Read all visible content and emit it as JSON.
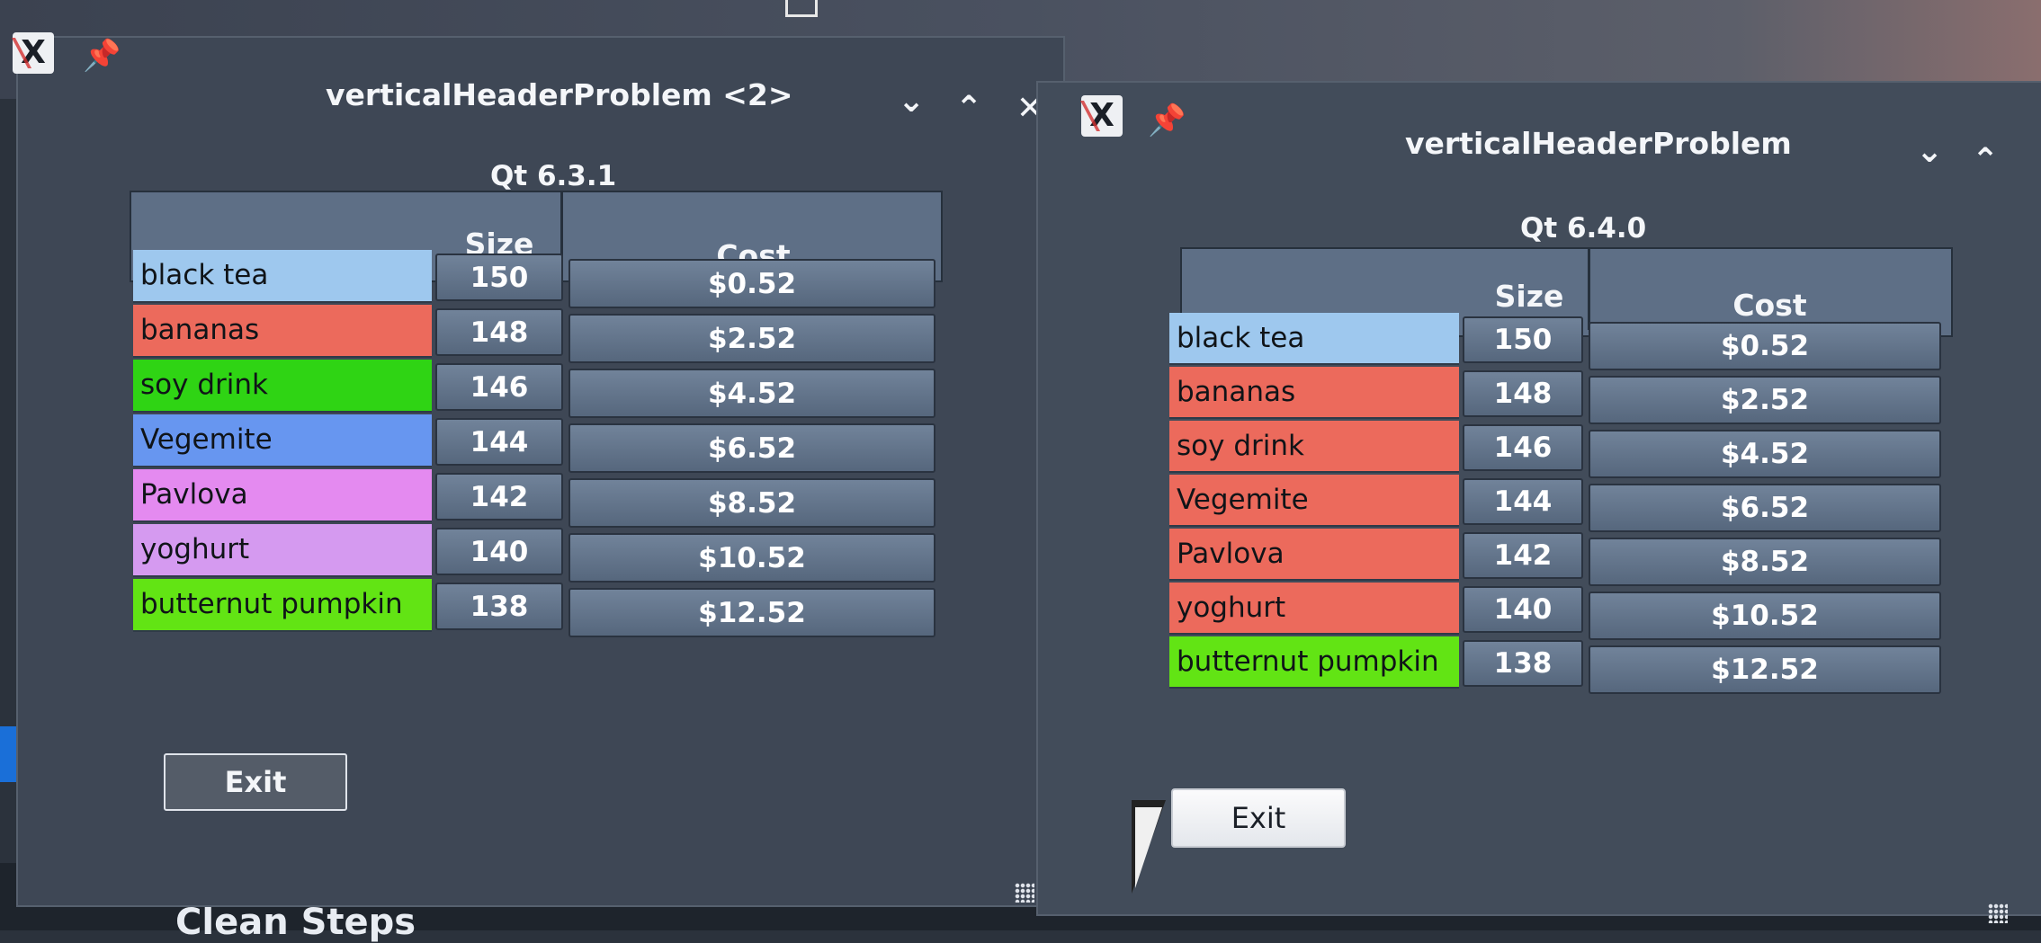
{
  "background": {
    "bottom_text": "Clean Steps"
  },
  "window1": {
    "title": "verticalHeaderProblem <2>",
    "version": "Qt 6.3.1",
    "columns": [
      "Size",
      "Cost"
    ],
    "exit_label": "Exit",
    "rows": [
      {
        "label": "black tea",
        "size": "150",
        "cost": "$0.52",
        "color": "#9ec8ee"
      },
      {
        "label": "bananas",
        "size": "148",
        "cost": "$2.52",
        "color": "#ec6a5c"
      },
      {
        "label": "soy drink",
        "size": "146",
        "cost": "$4.52",
        "color": "#2fd414"
      },
      {
        "label": "Vegemite",
        "size": "144",
        "cost": "$6.52",
        "color": "#6796f0"
      },
      {
        "label": "Pavlova",
        "size": "142",
        "cost": "$8.52",
        "color": "#e48af0"
      },
      {
        "label": "yoghurt",
        "size": "140",
        "cost": "$10.52",
        "color": "#d59af0"
      },
      {
        "label": "butternut pumpkin",
        "size": "138",
        "cost": "$12.52",
        "color": "#62e414"
      }
    ]
  },
  "window2": {
    "title": "verticalHeaderProblem",
    "version": "Qt 6.4.0",
    "columns": [
      "Size",
      "Cost"
    ],
    "exit_label": "Exit",
    "rows": [
      {
        "label": "black tea",
        "size": "150",
        "cost": "$0.52",
        "color": "#9ec8ee"
      },
      {
        "label": "bananas",
        "size": "148",
        "cost": "$2.52",
        "color": "#ec6a5c"
      },
      {
        "label": "soy drink",
        "size": "146",
        "cost": "$4.52",
        "color": "#ec6a5c"
      },
      {
        "label": "Vegemite",
        "size": "144",
        "cost": "$6.52",
        "color": "#ec6a5c"
      },
      {
        "label": "Pavlova",
        "size": "142",
        "cost": "$8.52",
        "color": "#ec6a5c"
      },
      {
        "label": "yoghurt",
        "size": "140",
        "cost": "$10.52",
        "color": "#ec6a5c"
      },
      {
        "label": "butternut pumpkin",
        "size": "138",
        "cost": "$12.52",
        "color": "#62e414"
      }
    ]
  },
  "icons": {
    "app_icon": "x-app-icon",
    "pin": "pin-icon",
    "minimize": "chevron-down-icon",
    "maximize": "chevron-up-icon",
    "close": "close-icon"
  }
}
